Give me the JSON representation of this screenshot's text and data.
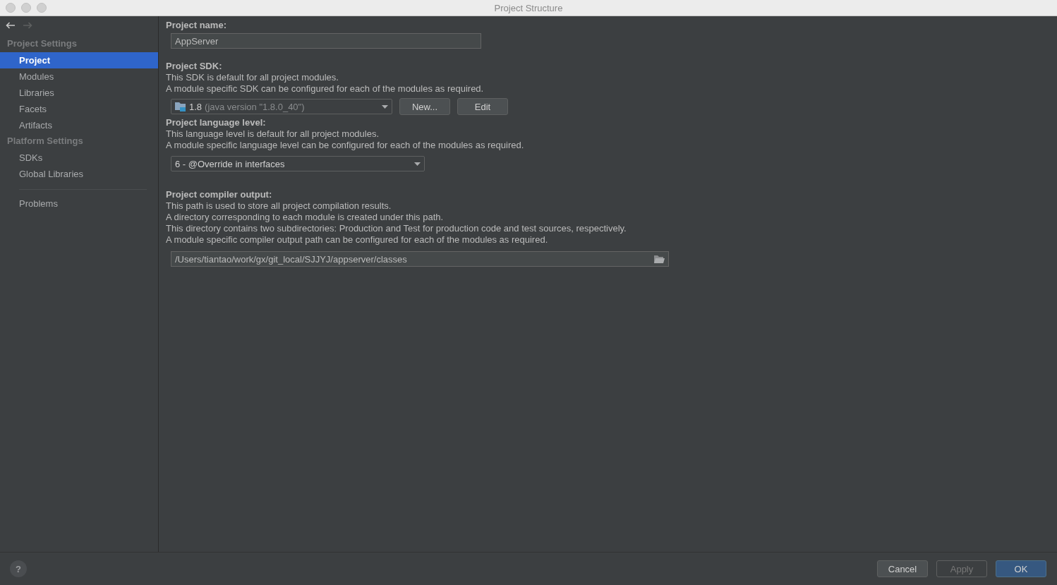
{
  "window": {
    "title": "Project Structure"
  },
  "nav": {
    "back_disabled": false,
    "forward_disabled": true
  },
  "sidebar": {
    "sections": [
      {
        "title": "Project Settings",
        "items": [
          {
            "label": "Project",
            "selected": true
          },
          {
            "label": "Modules",
            "selected": false
          },
          {
            "label": "Libraries",
            "selected": false
          },
          {
            "label": "Facets",
            "selected": false
          },
          {
            "label": "Artifacts",
            "selected": false
          }
        ]
      },
      {
        "title": "Platform Settings",
        "items": [
          {
            "label": "SDKs",
            "selected": false
          },
          {
            "label": "Global Libraries",
            "selected": false
          }
        ]
      }
    ],
    "footer_items": [
      {
        "label": "Problems",
        "selected": false
      }
    ]
  },
  "project_name": {
    "label": "Project name:",
    "value": "AppServer"
  },
  "project_sdk": {
    "label": "Project SDK:",
    "description": [
      "This SDK is default for all project modules.",
      "A module specific SDK can be configured for each of the modules as required."
    ],
    "sdk_name": "1.8",
    "sdk_detail": "(java version \"1.8.0_40\")",
    "buttons": [
      {
        "label": "New...",
        "disabled": false
      },
      {
        "label": "Edit",
        "disabled": false
      }
    ]
  },
  "language_level": {
    "label": "Project language level:",
    "description": [
      "This language level is default for all project modules.",
      "A module specific language level can be configured for each of the modules as required."
    ],
    "value": "6 - @Override in interfaces"
  },
  "compiler_output": {
    "label": "Project compiler output:",
    "description": [
      "This path is used to store all project compilation results.",
      "A directory corresponding to each module is created under this path.",
      "This directory contains two subdirectories: Production and Test for production code and test sources, respectively.",
      "A module specific compiler output path can be configured for each of the modules as required."
    ],
    "value": "/Users/tiantao/work/gx/git_local/SJJYJ/appserver/classes"
  },
  "help": {
    "label": "?"
  },
  "buttons": [
    {
      "label": "Cancel",
      "kind": "normal",
      "disabled": false
    },
    {
      "label": "Apply",
      "kind": "normal",
      "disabled": true
    },
    {
      "label": "OK",
      "kind": "default",
      "disabled": false
    }
  ]
}
